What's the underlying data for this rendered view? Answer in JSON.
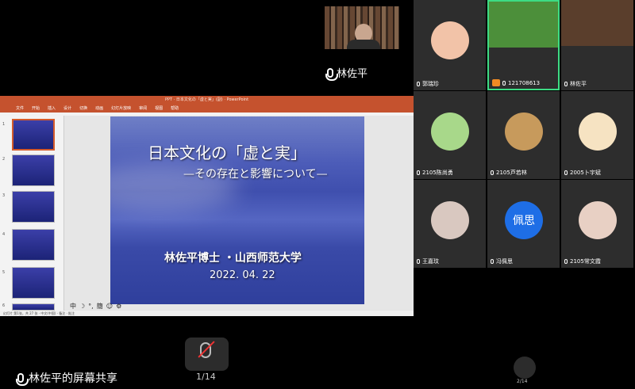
{
  "speaker": {
    "name": "林佐平"
  },
  "ppt": {
    "window_title": "PPT · 日本文化の「虚と実」(副) · PowerPoint",
    "ribbon": [
      "文件",
      "开始",
      "插入",
      "设计",
      "切换",
      "动画",
      "幻灯片放映",
      "审阅",
      "视图",
      "帮助"
    ],
    "status": "幻灯片 第1张，共 27 张 · 中文(中国) · 备注 · 批注"
  },
  "slide": {
    "title": "日本文化の「虚と実」",
    "subtitle": "—その存在と影響について—",
    "author": "林佐平博士 ・山西师范大学",
    "date": "2022. 04. 22"
  },
  "thumb_numbers": [
    "1",
    "2",
    "3",
    "4",
    "5",
    "6"
  ],
  "share": {
    "label": "林佐平的屏幕共享",
    "page": "1/14"
  },
  "gallery": {
    "page": "2/14",
    "participants": [
      {
        "name": "郭瑞珍",
        "kind": "avatar",
        "color": "#f2c3a8"
      },
      {
        "name": "121708613",
        "kind": "video",
        "color": "#4c8f3a",
        "host": true
      },
      {
        "name": "林佐平",
        "kind": "video",
        "color": "#5a3e2c"
      },
      {
        "name": "2105陈尚勇",
        "kind": "avatar",
        "color": "#a8d88a"
      },
      {
        "name": "2105芦若林",
        "kind": "avatar",
        "color": "#c79a5c"
      },
      {
        "name": "2005卜宇斌",
        "kind": "avatar",
        "color": "#f6e3c2"
      },
      {
        "name": "王嘉玟",
        "kind": "avatar",
        "color": "#d9c8c0"
      },
      {
        "name": "冯佩思",
        "kind": "initials",
        "initials": "佩思",
        "color": "#1e6ee6"
      },
      {
        "name": "2105常文霞",
        "kind": "avatar",
        "color": "#e8d0c4"
      }
    ]
  }
}
